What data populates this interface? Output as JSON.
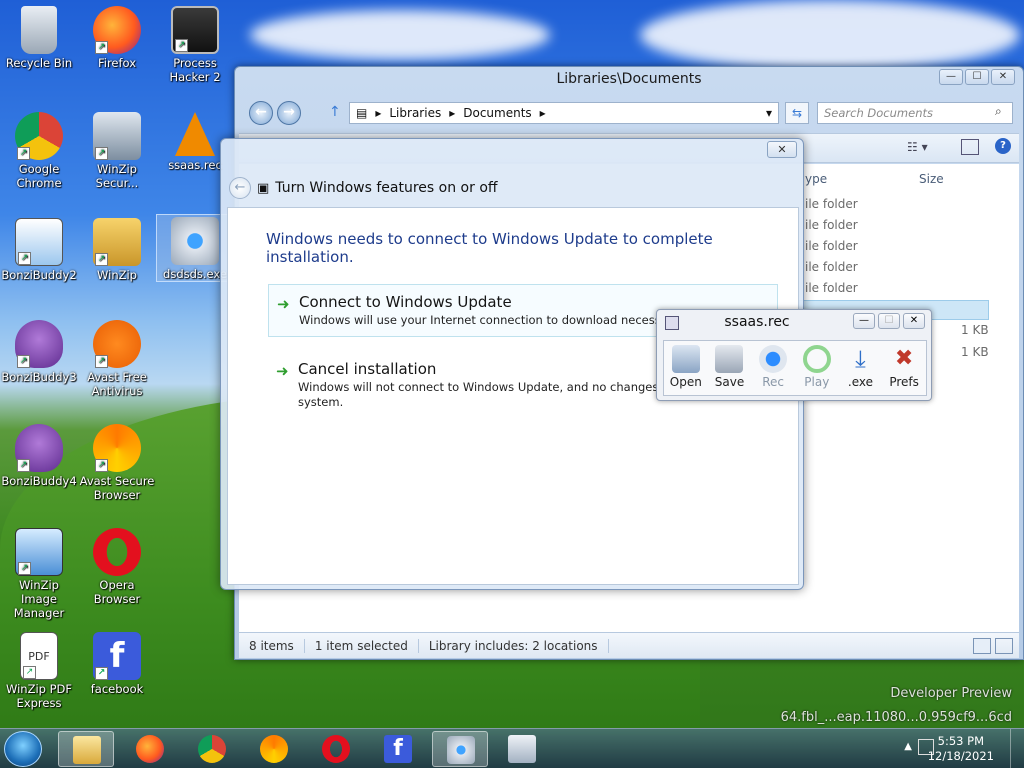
{
  "desktop": {
    "icons": [
      {
        "label": "Recycle Bin"
      },
      {
        "label": "Firefox"
      },
      {
        "label": "Process Hacker 2"
      },
      {
        "label": "Google Chrome"
      },
      {
        "label": "WinZip Secur..."
      },
      {
        "label": "ssaas.rec"
      },
      {
        "label": "BonziBuddy2"
      },
      {
        "label": "WinZip"
      },
      {
        "label": "dsdsds.exe"
      },
      {
        "label": "BonziBuddy3"
      },
      {
        "label": "Avast Free Antivirus"
      },
      {
        "label": "BonziBuddy4"
      },
      {
        "label": "Avast Secure Browser"
      },
      {
        "label": "WinZip Image Manager"
      },
      {
        "label": "Opera Browser"
      },
      {
        "label": "WinZip PDF Express"
      },
      {
        "label": "facebook"
      }
    ],
    "watermark_line1": "Developer Preview",
    "watermark_line2": "64.fbl_...eap.11080...0.959cf9...6cd"
  },
  "explorer": {
    "title": "Libraries\\Documents",
    "path": [
      "Libraries",
      "Documents"
    ],
    "search_placeholder": "Search Documents",
    "columns": {
      "type": "ype",
      "size": "Size"
    },
    "rows": [
      {
        "type": "ile folder",
        "size": ""
      },
      {
        "type": "ile folder",
        "size": ""
      },
      {
        "type": "ile folder",
        "size": ""
      },
      {
        "type": "ile folder",
        "size": ""
      },
      {
        "type": "ile folder",
        "size": ""
      },
      {
        "type": "",
        "size": "1 KB"
      },
      {
        "type": "",
        "size": "1 KB"
      }
    ],
    "status": {
      "items": "8 items",
      "selected": "1 item selected",
      "library": "Library includes: 2 locations"
    }
  },
  "dialog": {
    "title": "Turn Windows features on or off",
    "message": "Windows needs to connect to Windows Update to complete installation.",
    "option1_title": "Connect to Windows Update",
    "option1_desc": "Windows will use your Internet connection to download necessary f",
    "option2_title": "Cancel installation",
    "option2_desc1": "Windows will not connect to Windows Update, and no changes will",
    "option2_desc2": "system."
  },
  "recorder": {
    "title": "ssaas.rec",
    "tools": [
      {
        "label": "Open"
      },
      {
        "label": "Save"
      },
      {
        "label": "Rec"
      },
      {
        "label": "Play"
      },
      {
        "label": ".exe"
      },
      {
        "label": "Prefs"
      }
    ]
  },
  "taskbar": {
    "time": "5:53 PM",
    "date": "12/18/2021"
  },
  "colors": {
    "accent_blue": "#1e3c8c",
    "green_arrow": "#2f9e2f"
  }
}
